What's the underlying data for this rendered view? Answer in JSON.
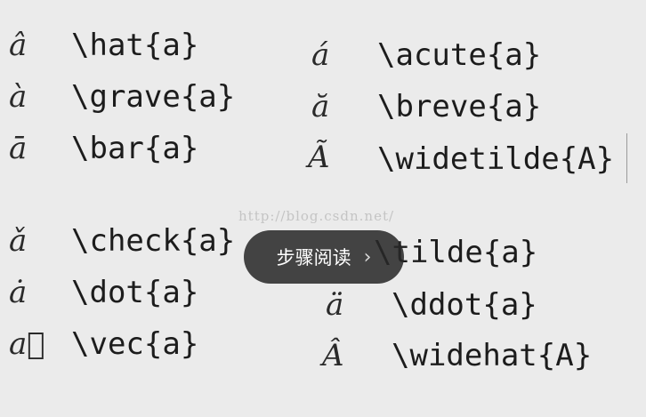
{
  "left_column": [
    {
      "symbol": "â",
      "command": "\\hat{a}"
    },
    {
      "symbol": "à",
      "command": "\\grave{a}"
    },
    {
      "symbol": "ā",
      "command": "\\bar{a}"
    },
    {
      "symbol": "ǎ",
      "command": "\\check{a}"
    },
    {
      "symbol": "ȧ",
      "command": "\\dot{a}"
    },
    {
      "symbol": "a⃗",
      "command": "\\vec{a}"
    }
  ],
  "right_column": [
    {
      "symbol": "á",
      "command": "\\acute{a}"
    },
    {
      "symbol": "ă",
      "command": "\\breve{a}"
    },
    {
      "symbol": "Ã",
      "command": "\\widetilde{A}"
    },
    {
      "symbol": "",
      "command": "\\tilde{a}"
    },
    {
      "symbol": "ä",
      "command": "\\ddot{a}"
    },
    {
      "symbol": "Â",
      "command": "\\widehat{A}"
    }
  ],
  "watermark": "http://blog.csdn.net/",
  "overlay_button": {
    "label": "步骤阅读",
    "icon": "chevron-right-icon"
  }
}
